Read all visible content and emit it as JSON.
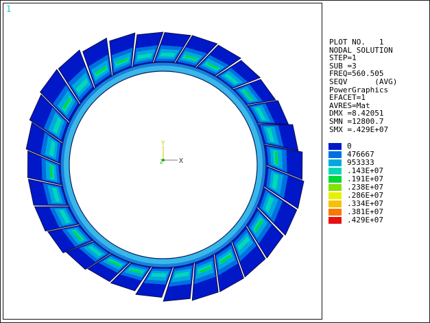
{
  "window_number": "1",
  "triad": {
    "x_label": "X",
    "y_label": "Y",
    "z_label": "Z"
  },
  "info": {
    "plot_no": "PLOT NO.   1",
    "solution_type": "NODAL SOLUTION",
    "step": "STEP=1",
    "sub": "SUB =3",
    "freq": "FREQ=560.505",
    "result": "SEQV      (AVG)",
    "graphics": "PowerGraphics",
    "efacet": "EFACET=1",
    "avres": "AVRES=Mat",
    "dmx": "DMX =8.42051",
    "smn": "SMN =12800.7",
    "smx": "SMX =.429E+07"
  },
  "contour_levels": [
    {
      "label": "0",
      "color": "#0018c8"
    },
    {
      "label": "476667",
      "color": "#0070e0"
    },
    {
      "label": "953333",
      "color": "#00a8e0"
    },
    {
      "label": ".143E+07",
      "color": "#00d8b8"
    },
    {
      "label": ".191E+07",
      "color": "#00d838"
    },
    {
      "label": ".238E+07",
      "color": "#88e000"
    },
    {
      "label": ".286E+07",
      "color": "#e8f000"
    },
    {
      "label": ".334E+07",
      "color": "#f8c000"
    },
    {
      "label": ".381E+07",
      "color": "#f87800"
    },
    {
      "label": ".429E+07",
      "color": "#e81010"
    }
  ]
}
